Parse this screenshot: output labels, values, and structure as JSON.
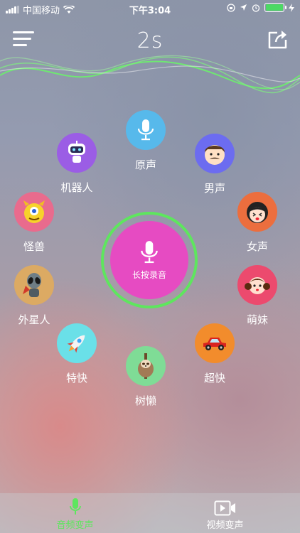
{
  "status_bar": {
    "carrier": "中国移动",
    "time": "下午3:04"
  },
  "header": {
    "timer": "2s"
  },
  "record": {
    "label": "长按录音"
  },
  "effects": [
    {
      "key": "original",
      "label": "原声",
      "color": "#57b9eb",
      "icon": "microphone-icon"
    },
    {
      "key": "robot",
      "label": "机器人",
      "color": "#9b5de5",
      "icon": "robot-icon"
    },
    {
      "key": "male",
      "label": "男声",
      "color": "#6c6cf0",
      "icon": "man-face-icon"
    },
    {
      "key": "monster",
      "label": "怪兽",
      "color": "#e96b8d",
      "icon": "monster-icon"
    },
    {
      "key": "female",
      "label": "女声",
      "color": "#ec6e3e",
      "icon": "woman-face-icon"
    },
    {
      "key": "alien",
      "label": "外星人",
      "color": "#dcaa63",
      "icon": "alien-icon"
    },
    {
      "key": "cute_girl",
      "label": "萌妹",
      "color": "#ec4a6e",
      "icon": "girl-face-icon"
    },
    {
      "key": "very_fast",
      "label": "特快",
      "color": "#6ae0e8",
      "icon": "rocket-icon"
    },
    {
      "key": "sloth",
      "label": "树懒",
      "color": "#7fdc96",
      "icon": "sloth-icon"
    },
    {
      "key": "super_fast",
      "label": "超快",
      "color": "#f28c2c",
      "icon": "car-icon"
    }
  ],
  "tabs": [
    {
      "label": "音频变声",
      "active": true,
      "color": "#5ee65e"
    },
    {
      "label": "视频变声",
      "active": false,
      "color": "#ffffff"
    }
  ]
}
